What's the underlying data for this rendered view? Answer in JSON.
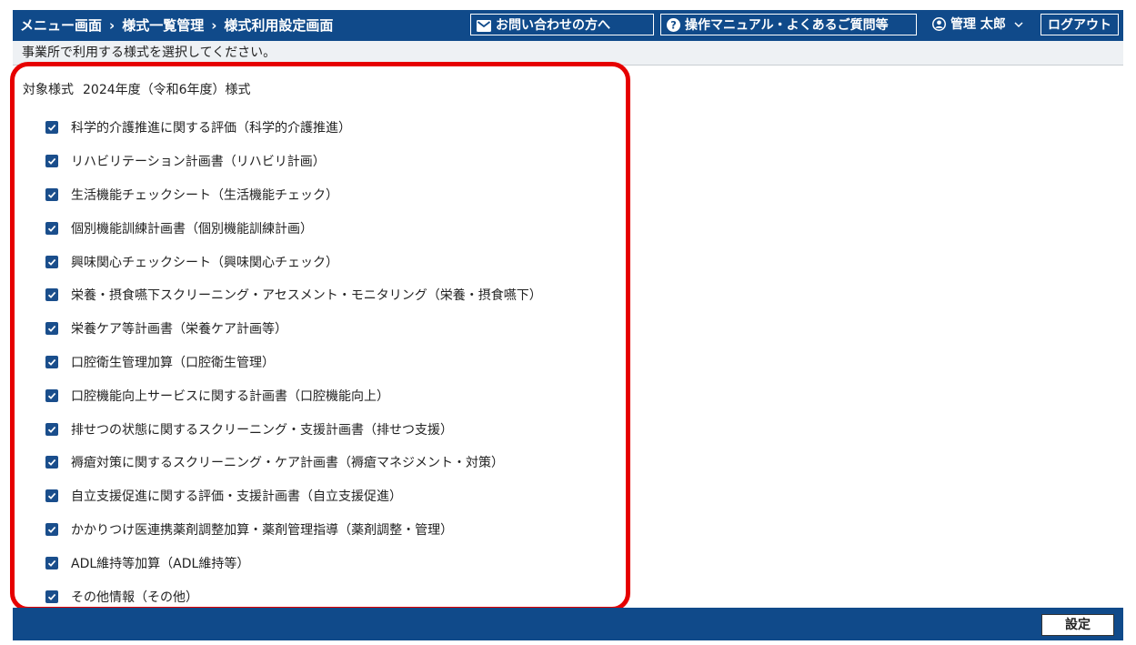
{
  "header": {
    "breadcrumb": [
      "メニュー画面",
      "様式一覧管理",
      "様式利用設定画面"
    ],
    "separator": "›",
    "contact_label": "お問い合わせの方へ",
    "contact_icon": "mail-icon",
    "manual_label": "操作マニュアル・よくあるご質問等",
    "manual_icon": "question-circle-icon",
    "user_name": "管理 太郎",
    "user_icon": "user-circle-icon",
    "logout_label": "ログアウト",
    "colors": {
      "primary": "#104a8a",
      "text": "#ffffff"
    }
  },
  "instruction": "事業所で利用する様式を選択してください。",
  "target": {
    "label": "対象様式",
    "year": "2024年度（令和6年度）様式"
  },
  "forms": [
    {
      "label": "科学的介護推進に関する評価（科学的介護推進）",
      "checked": true
    },
    {
      "label": "リハビリテーション計画書（リハビリ計画）",
      "checked": true
    },
    {
      "label": "生活機能チェックシート（生活機能チェック）",
      "checked": true
    },
    {
      "label": "個別機能訓練計画書（個別機能訓練計画）",
      "checked": true
    },
    {
      "label": "興味関心チェックシート（興味関心チェック）",
      "checked": true
    },
    {
      "label": "栄養・摂食嚥下スクリーニング・アセスメント・モニタリング（栄養・摂食嚥下）",
      "checked": true
    },
    {
      "label": "栄養ケア等計画書（栄養ケア計画等）",
      "checked": true
    },
    {
      "label": "口腔衛生管理加算（口腔衛生管理）",
      "checked": true
    },
    {
      "label": "口腔機能向上サービスに関する計画書（口腔機能向上）",
      "checked": true
    },
    {
      "label": "排せつの状態に関するスクリーニング・支援計画書（排せつ支援）",
      "checked": true
    },
    {
      "label": "褥瘡対策に関するスクリーニング・ケア計画書（褥瘡マネジメント・対策）",
      "checked": true
    },
    {
      "label": "自立支援促進に関する評価・支援計画書（自立支援促進）",
      "checked": true
    },
    {
      "label": "かかりつけ医連携薬剤調整加算・薬剤管理指導（薬剤調整・管理）",
      "checked": true
    },
    {
      "label": "ADL維持等加算（ADL維持等）",
      "checked": true
    },
    {
      "label": "その他情報（その他）",
      "checked": true
    }
  ],
  "footer": {
    "set_label": "設定"
  },
  "highlight_color": "#e60000"
}
